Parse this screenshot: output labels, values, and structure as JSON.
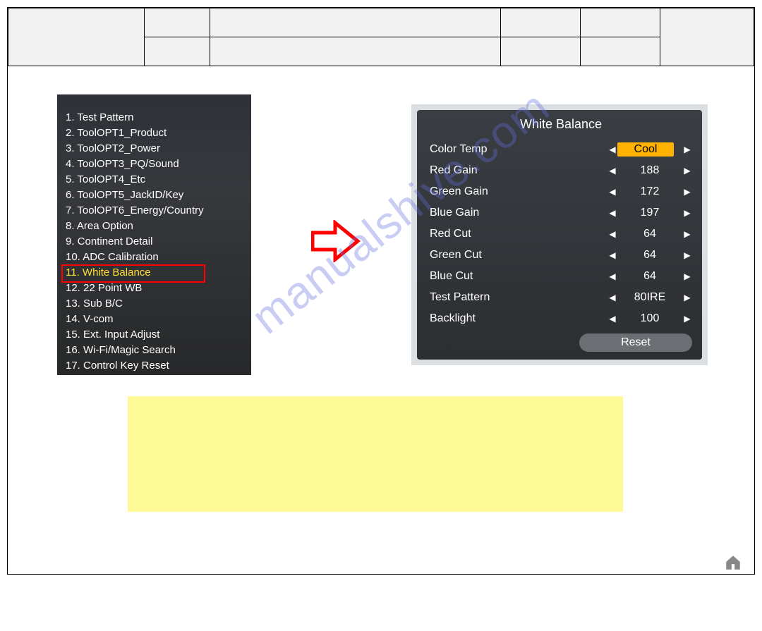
{
  "watermark": "manualshive.com",
  "left_menu": {
    "items": [
      "1. Test Pattern",
      "2. ToolOPT1_Product",
      "3. ToolOPT2_Power",
      "4. ToolOPT3_PQ/Sound",
      "5. ToolOPT4_Etc",
      "6. ToolOPT5_JackID/Key",
      "7. ToolOPT6_Energy/Country",
      "8. Area Option",
      "9. Continent Detail",
      "10. ADC Calibration",
      "11. White Balance",
      "12. 22 Point WB",
      "13. Sub B/C",
      "14. V-com",
      "15. Ext. Input Adjust",
      "16. Wi-Fi/Magic Search",
      "17. Control Key Reset"
    ],
    "selected_index": 10
  },
  "right_menu": {
    "title": "White Balance",
    "rows": [
      {
        "label": "Color Temp",
        "value": "Cool",
        "is_badge": true
      },
      {
        "label": "Red Gain",
        "value": "188"
      },
      {
        "label": "Green Gain",
        "value": "172"
      },
      {
        "label": "Blue Gain",
        "value": "197"
      },
      {
        "label": "Red Cut",
        "value": "64"
      },
      {
        "label": "Green Cut",
        "value": "64"
      },
      {
        "label": "Blue Cut",
        "value": "64"
      },
      {
        "label": "Test Pattern",
        "value": "80IRE"
      },
      {
        "label": "Backlight",
        "value": "100"
      }
    ],
    "reset_label": "Reset"
  }
}
